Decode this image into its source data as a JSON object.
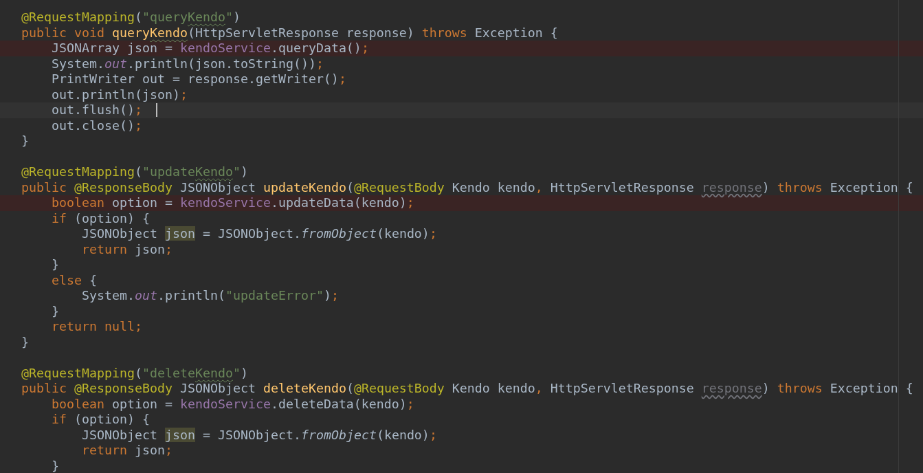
{
  "editor": {
    "lines": [
      {
        "kind": "code",
        "tokens": [
          {
            "text": "@RequestMapping",
            "kind": "annotation"
          },
          {
            "text": "(",
            "kind": "plain"
          },
          {
            "text": "\"query",
            "kind": "string"
          },
          {
            "text": "Kendo",
            "kind": "string",
            "typo": true
          },
          {
            "text": "\"",
            "kind": "string"
          },
          {
            "text": ")",
            "kind": "plain"
          }
        ]
      },
      {
        "kind": "code",
        "tokens": [
          {
            "text": "public void ",
            "kind": "keyword"
          },
          {
            "text": "query",
            "kind": "method"
          },
          {
            "text": "Kendo",
            "kind": "method",
            "typo": true
          },
          {
            "text": "(HttpServletResponse response) ",
            "kind": "plain"
          },
          {
            "text": "throws",
            "kind": "keyword"
          },
          {
            "text": " Exception {",
            "kind": "plain"
          }
        ]
      },
      {
        "kind": "code",
        "breakpoint": true,
        "tokens": [
          {
            "text": "    JSONArray json = ",
            "kind": "plain"
          },
          {
            "text": "kendoService",
            "kind": "field"
          },
          {
            "text": ".queryData()",
            "kind": "plain"
          },
          {
            "text": ";",
            "kind": "keyword"
          }
        ]
      },
      {
        "kind": "code",
        "tokens": [
          {
            "text": "    System.",
            "kind": "plain"
          },
          {
            "text": "out",
            "kind": "static"
          },
          {
            "text": ".println(json.toString())",
            "kind": "plain"
          },
          {
            "text": ";",
            "kind": "keyword"
          }
        ]
      },
      {
        "kind": "code",
        "tokens": [
          {
            "text": "    PrintWriter out = response.getWriter()",
            "kind": "plain"
          },
          {
            "text": ";",
            "kind": "keyword"
          }
        ]
      },
      {
        "kind": "code",
        "tokens": [
          {
            "text": "    out.println(json)",
            "kind": "plain"
          },
          {
            "text": ";",
            "kind": "keyword"
          }
        ]
      },
      {
        "kind": "code",
        "caret": true,
        "tokens": [
          {
            "text": "    out.flush()",
            "kind": "plain"
          },
          {
            "text": ";",
            "kind": "keyword"
          }
        ]
      },
      {
        "kind": "code",
        "tokens": [
          {
            "text": "    out.close()",
            "kind": "plain"
          },
          {
            "text": ";",
            "kind": "keyword"
          }
        ]
      },
      {
        "kind": "code",
        "tokens": [
          {
            "text": "}",
            "kind": "plain"
          }
        ]
      },
      {
        "kind": "blank"
      },
      {
        "kind": "code",
        "tokens": [
          {
            "text": "@RequestMapping",
            "kind": "annotation"
          },
          {
            "text": "(",
            "kind": "plain"
          },
          {
            "text": "\"update",
            "kind": "string"
          },
          {
            "text": "Kendo",
            "kind": "string",
            "typo": true
          },
          {
            "text": "\"",
            "kind": "string"
          },
          {
            "text": ")",
            "kind": "plain"
          }
        ]
      },
      {
        "kind": "code",
        "tokens": [
          {
            "text": "public ",
            "kind": "keyword"
          },
          {
            "text": "@ResponseBody",
            "kind": "annotation"
          },
          {
            "text": " JSONObject ",
            "kind": "plain"
          },
          {
            "text": "updateKendo",
            "kind": "method"
          },
          {
            "text": "(",
            "kind": "plain"
          },
          {
            "text": "@RequestBody",
            "kind": "annotation"
          },
          {
            "text": " Kendo kendo",
            "kind": "plain"
          },
          {
            "text": ", ",
            "kind": "keyword"
          },
          {
            "text": "HttpServletResponse ",
            "kind": "plain"
          },
          {
            "text": "response",
            "kind": "unused"
          },
          {
            "text": ") ",
            "kind": "plain"
          },
          {
            "text": "throws",
            "kind": "keyword"
          },
          {
            "text": " Exception {",
            "kind": "plain"
          }
        ]
      },
      {
        "kind": "code",
        "breakpoint": true,
        "tokens": [
          {
            "text": "    boolean",
            "kind": "keyword"
          },
          {
            "text": " option = ",
            "kind": "plain"
          },
          {
            "text": "kendoService",
            "kind": "field"
          },
          {
            "text": ".updateData(kendo)",
            "kind": "plain"
          },
          {
            "text": ";",
            "kind": "keyword"
          }
        ]
      },
      {
        "kind": "code",
        "tokens": [
          {
            "text": "    if",
            "kind": "keyword"
          },
          {
            "text": " (option) {",
            "kind": "plain"
          }
        ]
      },
      {
        "kind": "code",
        "tokens": [
          {
            "text": "        JSONObject ",
            "kind": "plain"
          },
          {
            "text": "json",
            "kind": "plain",
            "marked": true
          },
          {
            "text": " = JSONObject.",
            "kind": "plain"
          },
          {
            "text": "fromObject",
            "kind": "static-call"
          },
          {
            "text": "(kendo)",
            "kind": "plain"
          },
          {
            "text": ";",
            "kind": "keyword"
          }
        ]
      },
      {
        "kind": "code",
        "tokens": [
          {
            "text": "        return",
            "kind": "keyword"
          },
          {
            "text": " json",
            "kind": "plain"
          },
          {
            "text": ";",
            "kind": "keyword"
          }
        ]
      },
      {
        "kind": "code",
        "tokens": [
          {
            "text": "    }",
            "kind": "plain"
          }
        ]
      },
      {
        "kind": "code",
        "tokens": [
          {
            "text": "    else",
            "kind": "keyword"
          },
          {
            "text": " {",
            "kind": "plain"
          }
        ]
      },
      {
        "kind": "code",
        "tokens": [
          {
            "text": "        System.",
            "kind": "plain"
          },
          {
            "text": "out",
            "kind": "static"
          },
          {
            "text": ".println(",
            "kind": "plain"
          },
          {
            "text": "\"updateError\"",
            "kind": "string"
          },
          {
            "text": ")",
            "kind": "plain"
          },
          {
            "text": ";",
            "kind": "keyword"
          }
        ]
      },
      {
        "kind": "code",
        "tokens": [
          {
            "text": "    }",
            "kind": "plain"
          }
        ]
      },
      {
        "kind": "code",
        "tokens": [
          {
            "text": "    return null;",
            "kind": "keyword"
          }
        ]
      },
      {
        "kind": "code",
        "tokens": [
          {
            "text": "}",
            "kind": "plain"
          }
        ]
      },
      {
        "kind": "blank"
      },
      {
        "kind": "code",
        "tokens": [
          {
            "text": "@RequestMapping",
            "kind": "annotation"
          },
          {
            "text": "(",
            "kind": "plain"
          },
          {
            "text": "\"delete",
            "kind": "string"
          },
          {
            "text": "Kendo",
            "kind": "string",
            "typo": true
          },
          {
            "text": "\"",
            "kind": "string"
          },
          {
            "text": ")",
            "kind": "plain"
          }
        ]
      },
      {
        "kind": "code",
        "tokens": [
          {
            "text": "public ",
            "kind": "keyword"
          },
          {
            "text": "@ResponseBody",
            "kind": "annotation"
          },
          {
            "text": " JSONObject ",
            "kind": "plain"
          },
          {
            "text": "deleteKendo",
            "kind": "method"
          },
          {
            "text": "(",
            "kind": "plain"
          },
          {
            "text": "@RequestBody",
            "kind": "annotation"
          },
          {
            "text": " Kendo kendo",
            "kind": "plain"
          },
          {
            "text": ", ",
            "kind": "keyword"
          },
          {
            "text": "HttpServletResponse ",
            "kind": "plain"
          },
          {
            "text": "response",
            "kind": "unused"
          },
          {
            "text": ") ",
            "kind": "plain"
          },
          {
            "text": "throws",
            "kind": "keyword"
          },
          {
            "text": " Exception {",
            "kind": "plain"
          }
        ]
      },
      {
        "kind": "code",
        "tokens": [
          {
            "text": "    boolean",
            "kind": "keyword"
          },
          {
            "text": " option = ",
            "kind": "plain"
          },
          {
            "text": "kendoService",
            "kind": "field"
          },
          {
            "text": ".deleteData(kendo)",
            "kind": "plain"
          },
          {
            "text": ";",
            "kind": "keyword"
          }
        ]
      },
      {
        "kind": "code",
        "tokens": [
          {
            "text": "    if",
            "kind": "keyword"
          },
          {
            "text": " (option) {",
            "kind": "plain"
          }
        ]
      },
      {
        "kind": "code",
        "tokens": [
          {
            "text": "        JSONObject ",
            "kind": "plain"
          },
          {
            "text": "json",
            "kind": "plain",
            "marked": true
          },
          {
            "text": " = JSONObject.",
            "kind": "plain"
          },
          {
            "text": "fromObject",
            "kind": "static-call"
          },
          {
            "text": "(kendo)",
            "kind": "plain"
          },
          {
            "text": ";",
            "kind": "keyword"
          }
        ]
      },
      {
        "kind": "code",
        "tokens": [
          {
            "text": "        return",
            "kind": "keyword"
          },
          {
            "text": " json",
            "kind": "plain"
          },
          {
            "text": ";",
            "kind": "keyword"
          }
        ]
      },
      {
        "kind": "code",
        "tokens": [
          {
            "text": "    }",
            "kind": "plain"
          }
        ]
      }
    ]
  }
}
